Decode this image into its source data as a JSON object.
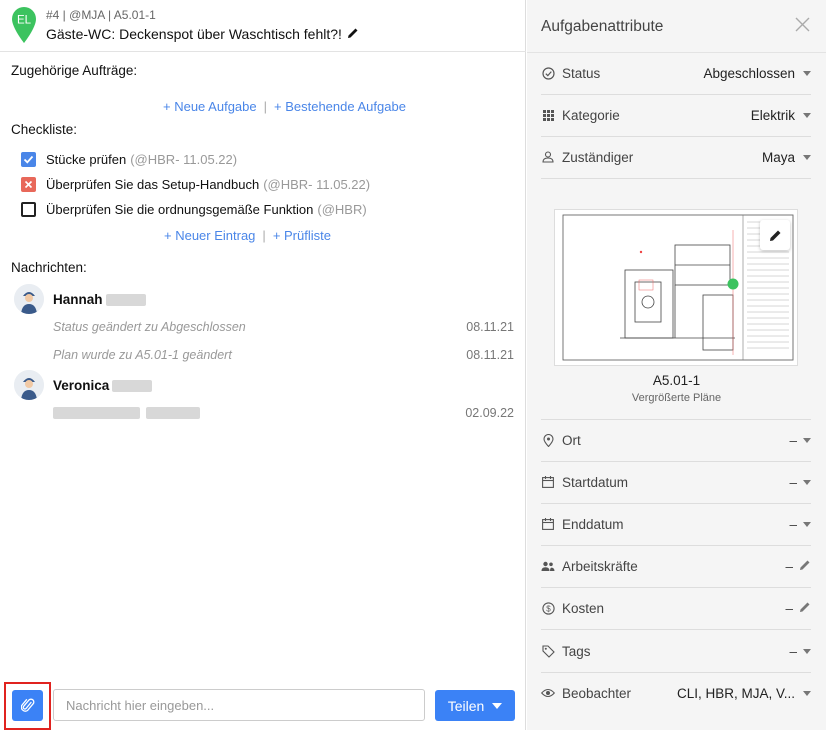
{
  "task": {
    "avatar_initials": "EL",
    "meta": "#4 | @MJA | A5.01-1",
    "title": "Gäste-WC: Deckenspot über Waschtisch fehlt?!"
  },
  "related": {
    "label": "Zugehörige Aufträge:",
    "new_task": "+ Neue Aufgabe",
    "existing_task": "+ Bestehende Aufgabe"
  },
  "checklist": {
    "label": "Checkliste:",
    "items": [
      {
        "text": "Stücke prüfen",
        "meta": "(@HBR- 11.05.22)",
        "state": "done"
      },
      {
        "text": "Überprüfen Sie das Setup-Handbuch",
        "meta": "(@HBR- 11.05.22)",
        "state": "failed"
      },
      {
        "text": "Überprüfen Sie die ordnungsgemäße Funktion",
        "meta": "(@HBR)",
        "state": "open"
      }
    ],
    "new_entry": "+ Neuer Eintrag",
    "checklist_link": "+ Prüfliste"
  },
  "messages": {
    "label": "Nachrichten:",
    "threads": [
      {
        "author": "Hannah",
        "lines": [
          {
            "text": "Status geändert zu Abgeschlossen",
            "date": "08.11.21"
          },
          {
            "text": "Plan wurde zu A5.01-1 geändert",
            "date": "08.11.21"
          }
        ]
      },
      {
        "author": "Veronica",
        "lines": [
          {
            "text": "",
            "date": "02.09.22"
          }
        ]
      }
    ]
  },
  "composer": {
    "placeholder": "Nachricht hier eingeben...",
    "share_label": "Teilen"
  },
  "attributes": {
    "title": "Aufgabenattribute",
    "status": {
      "label": "Status",
      "value": "Abgeschlossen"
    },
    "category": {
      "label": "Kategorie",
      "value": "Elektrik"
    },
    "assignee": {
      "label": "Zuständiger",
      "value": "Maya"
    },
    "plan": {
      "name": "A5.01-1",
      "subtitle": "Vergrößerte Pläne"
    },
    "location": {
      "label": "Ort",
      "value": "–"
    },
    "start_date": {
      "label": "Startdatum",
      "value": "–"
    },
    "end_date": {
      "label": "Enddatum",
      "value": "–"
    },
    "workers": {
      "label": "Arbeitskräfte",
      "value": "–"
    },
    "costs": {
      "label": "Kosten",
      "value": "–"
    },
    "tags": {
      "label": "Tags",
      "value": "–"
    },
    "watchers": {
      "label": "Beobachter",
      "value": "CLI, HBR, MJA, V..."
    }
  },
  "colors": {
    "accent": "#3b82f6",
    "link": "#4a86e8",
    "pin_green": "#3cc35f",
    "failed": "#e8685a",
    "highlight": "#e0231f"
  }
}
